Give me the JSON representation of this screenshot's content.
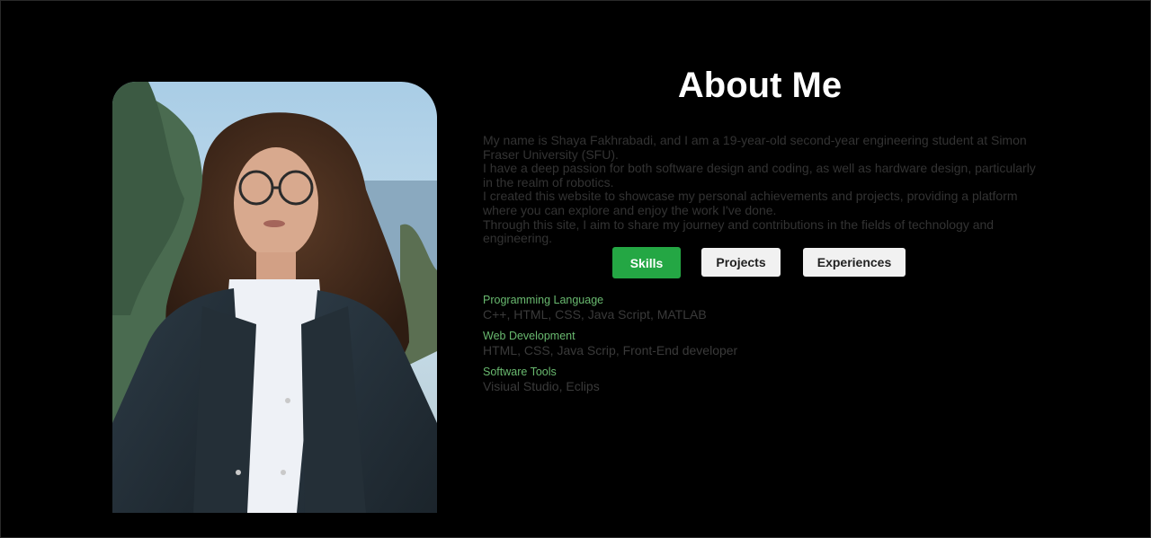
{
  "about": {
    "title": "About Me",
    "bio": [
      "My name is Shaya Fakhrabadi, and I am a 19-year-old second-year engineering student at Simon Fraser University (SFU).",
      "I have a deep passion for both software design and coding, as well as hardware design, particularly in the realm of robotics.",
      "I created this website to showcase my personal achievements and projects, providing a platform where you can explore and enjoy the work I've done.",
      "Through this site, I aim to share my journey and contributions in the fields of technology and engineering."
    ]
  },
  "tabs": {
    "skills": "Skills",
    "projects": "Projects",
    "experiences": "Experiences",
    "active": "skills"
  },
  "skills": [
    {
      "heading": "Programming Language",
      "items": "C++, HTML, CSS, Java Script, MATLAB"
    },
    {
      "heading": "Web Development",
      "items": "HTML, CSS, Java Scrip, Front-End developer"
    },
    {
      "heading": "Software Tools",
      "items": "Visiual Studio, Eclips"
    }
  ],
  "colors": {
    "background": "#000000",
    "title": "#ffffff",
    "body_text": "#333333",
    "active_tab": "#24a744",
    "inactive_tab": "#f1f1f1",
    "skill_heading": "#69b96f"
  },
  "icons": {
    "portrait": "profile-photo"
  }
}
